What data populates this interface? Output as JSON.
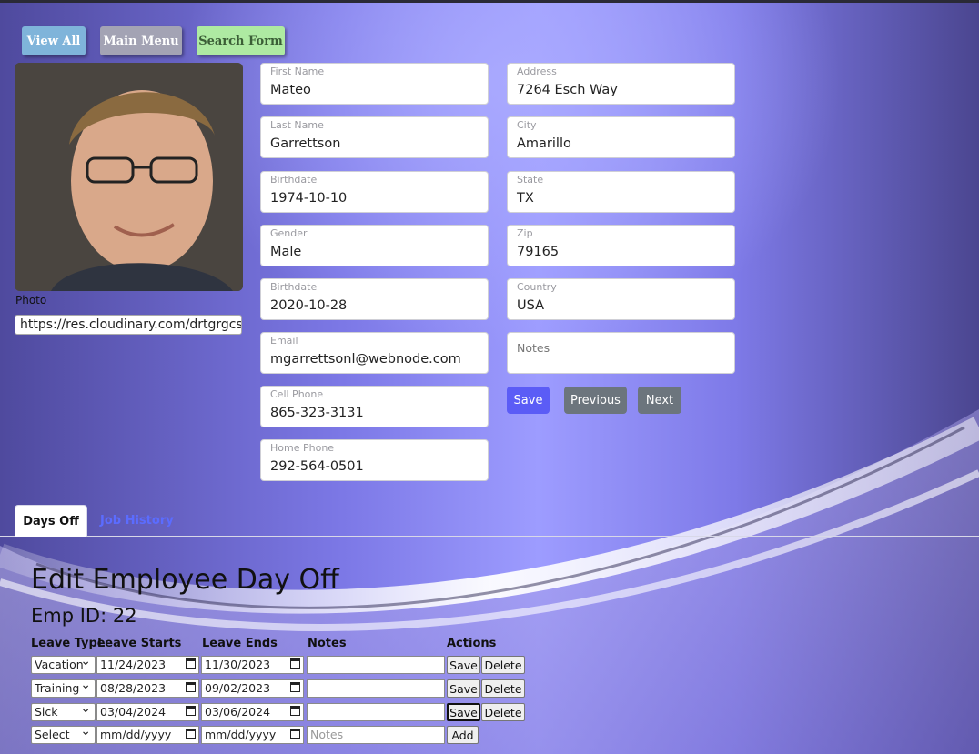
{
  "nav": {
    "view_all": "View All",
    "main_menu": "Main Menu",
    "search_form": "Search Form"
  },
  "photo": {
    "label": "Photo",
    "url": "https://res.cloudinary.com/drtgrgcs"
  },
  "left_fields": [
    {
      "label": "First Name",
      "value": "Mateo"
    },
    {
      "label": "Last Name",
      "value": "Garrettson"
    },
    {
      "label": "Birthdate",
      "value": "1974-10-10"
    },
    {
      "label": "Gender",
      "value": "Male"
    },
    {
      "label": "Birthdate",
      "value": "2020-10-28"
    },
    {
      "label": "Email",
      "value": "mgarrettsonl@webnode.com"
    },
    {
      "label": "Cell Phone",
      "value": "865-323-3131"
    },
    {
      "label": "Home Phone",
      "value": "292-564-0501"
    }
  ],
  "right_fields": [
    {
      "label": "Address",
      "value": "7264 Esch Way"
    },
    {
      "label": "City",
      "value": "Amarillo"
    },
    {
      "label": "State",
      "value": "TX"
    },
    {
      "label": "Zip",
      "value": "79165"
    },
    {
      "label": "Country",
      "value": "USA"
    }
  ],
  "notes_placeholder": "Notes",
  "actions": {
    "save": "Save",
    "previous": "Previous",
    "next": "Next"
  },
  "tabs": {
    "days_off": "Days Off",
    "job_history": "Job History"
  },
  "days_off": {
    "title": "Edit Employee Day Off",
    "emp_id": "Emp ID: 22",
    "headers": {
      "leave_type": "Leave Type",
      "leave_starts": "Leave Starts",
      "leave_ends": "Leave Ends",
      "notes": "Notes",
      "actions": "Actions"
    },
    "rows": [
      {
        "type": "Vacation",
        "start": "11/24/2023",
        "end": "11/30/2023",
        "notes": ""
      },
      {
        "type": "Training",
        "start": "08/28/2023",
        "end": "09/02/2023",
        "notes": ""
      },
      {
        "type": "Sick",
        "start": "03/04/2024",
        "end": "03/06/2024",
        "notes": ""
      }
    ],
    "new_row": {
      "type": "Select",
      "start": "mm/dd/yyyy",
      "end": "mm/dd/yyyy",
      "notes_placeholder": "Notes"
    },
    "save_label": "Save",
    "delete_label": "Delete",
    "add_label": "Add"
  }
}
